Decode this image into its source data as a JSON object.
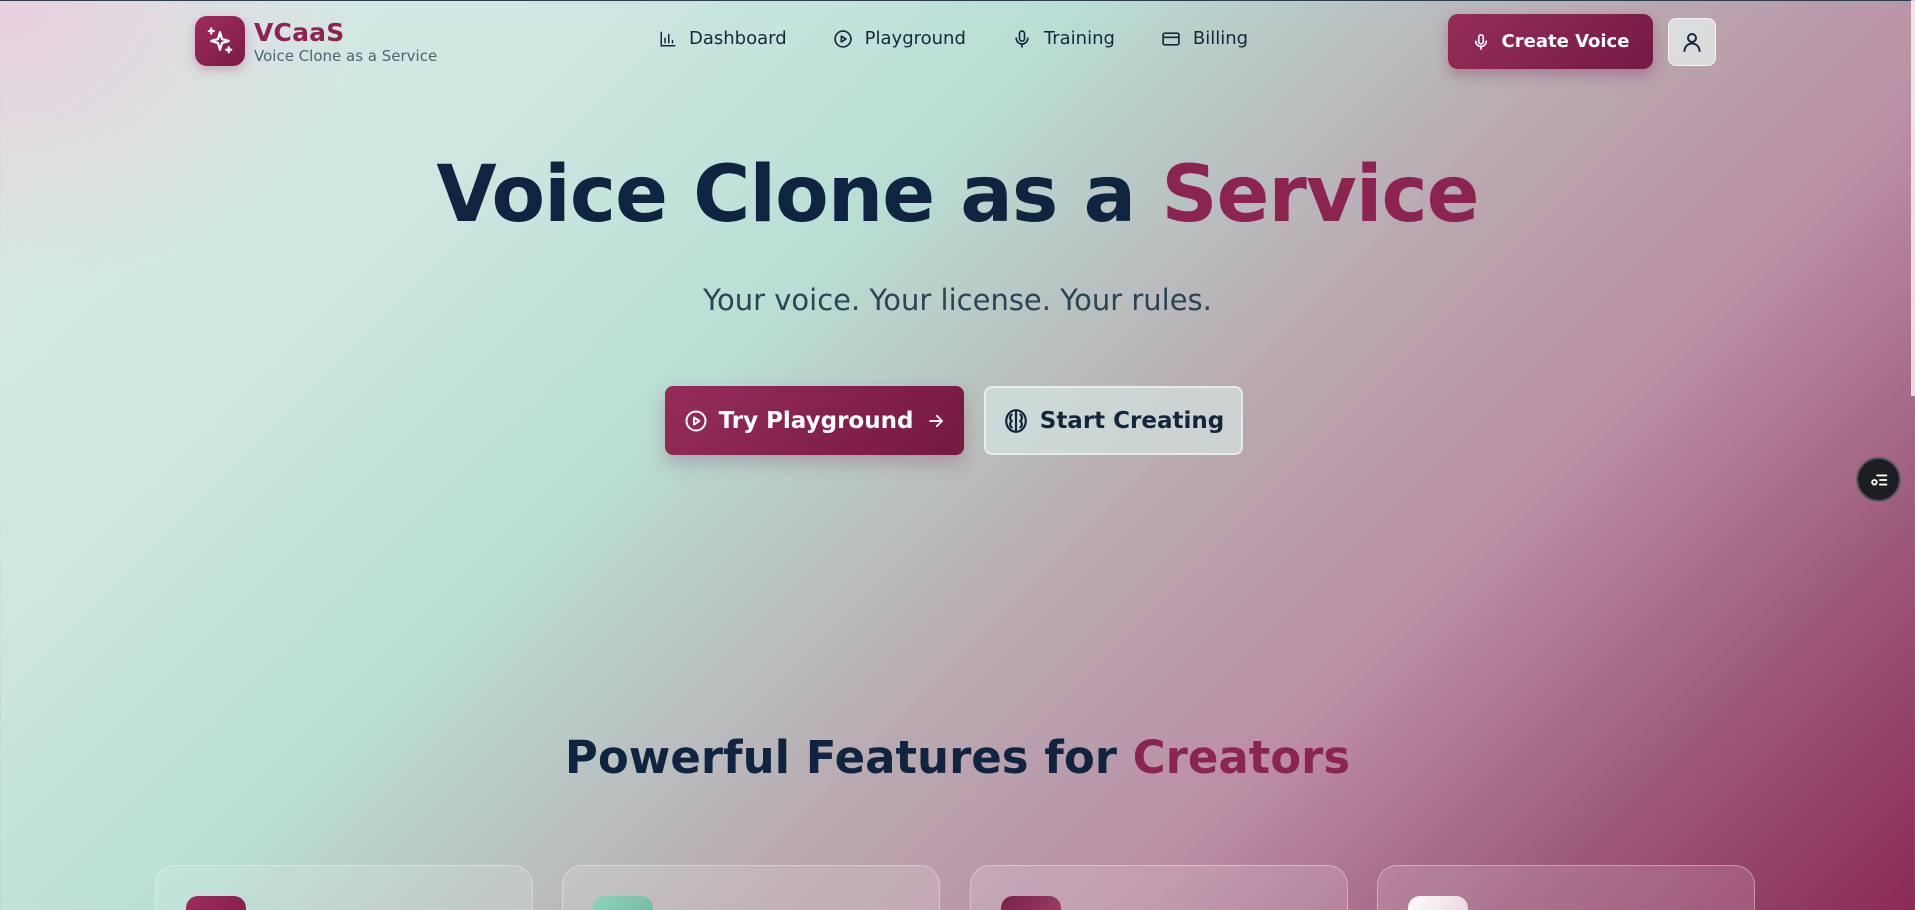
{
  "brand": {
    "name": "VCaaS",
    "tagline": "Voice Clone as a Service",
    "color": "#8c2452"
  },
  "nav": {
    "items": [
      {
        "label": "Dashboard",
        "icon": "bar-chart-icon"
      },
      {
        "label": "Playground",
        "icon": "play-circle-icon"
      },
      {
        "label": "Training",
        "icon": "microphone-icon"
      },
      {
        "label": "Billing",
        "icon": "credit-card-icon"
      }
    ],
    "create_voice_label": "Create Voice",
    "user_icon": "user-icon"
  },
  "hero": {
    "title_main": "Voice Clone as a ",
    "title_accent": "Service",
    "subtitle": "Your voice. Your license. Your rules.",
    "primary_cta": "Try Playground",
    "secondary_cta": "Start Creating"
  },
  "features": {
    "title_main": "Powerful Features for ",
    "title_accent": "Creators",
    "card_icon_colors": [
      "#8c2452",
      "#7cc4ad",
      "#8a2a52",
      "#f3e6ea"
    ]
  },
  "colors": {
    "primary": "#8c2452",
    "text_dark": "#0f2440"
  }
}
